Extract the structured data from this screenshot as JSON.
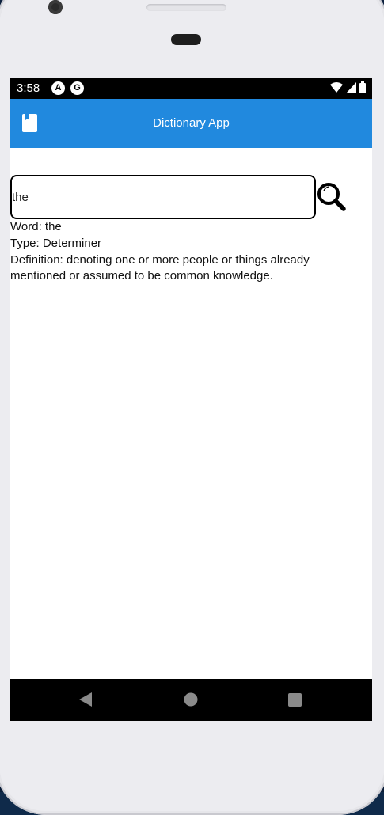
{
  "status_bar": {
    "time": "3:58",
    "notification_icons": [
      "A",
      "G"
    ]
  },
  "app_bar": {
    "title": "Dictionary App",
    "icon": "book-icon",
    "color": "#2189de"
  },
  "search": {
    "value": "the",
    "placeholder": "",
    "button_icon": "search-icon"
  },
  "result": {
    "word": "Word: the",
    "type": "Type: Determiner",
    "definition": "Definition: denoting one or more people or things already mentioned or assumed to be common knowledge."
  },
  "nav_bar": {
    "buttons": [
      "back-icon",
      "home-icon",
      "recents-icon"
    ]
  }
}
